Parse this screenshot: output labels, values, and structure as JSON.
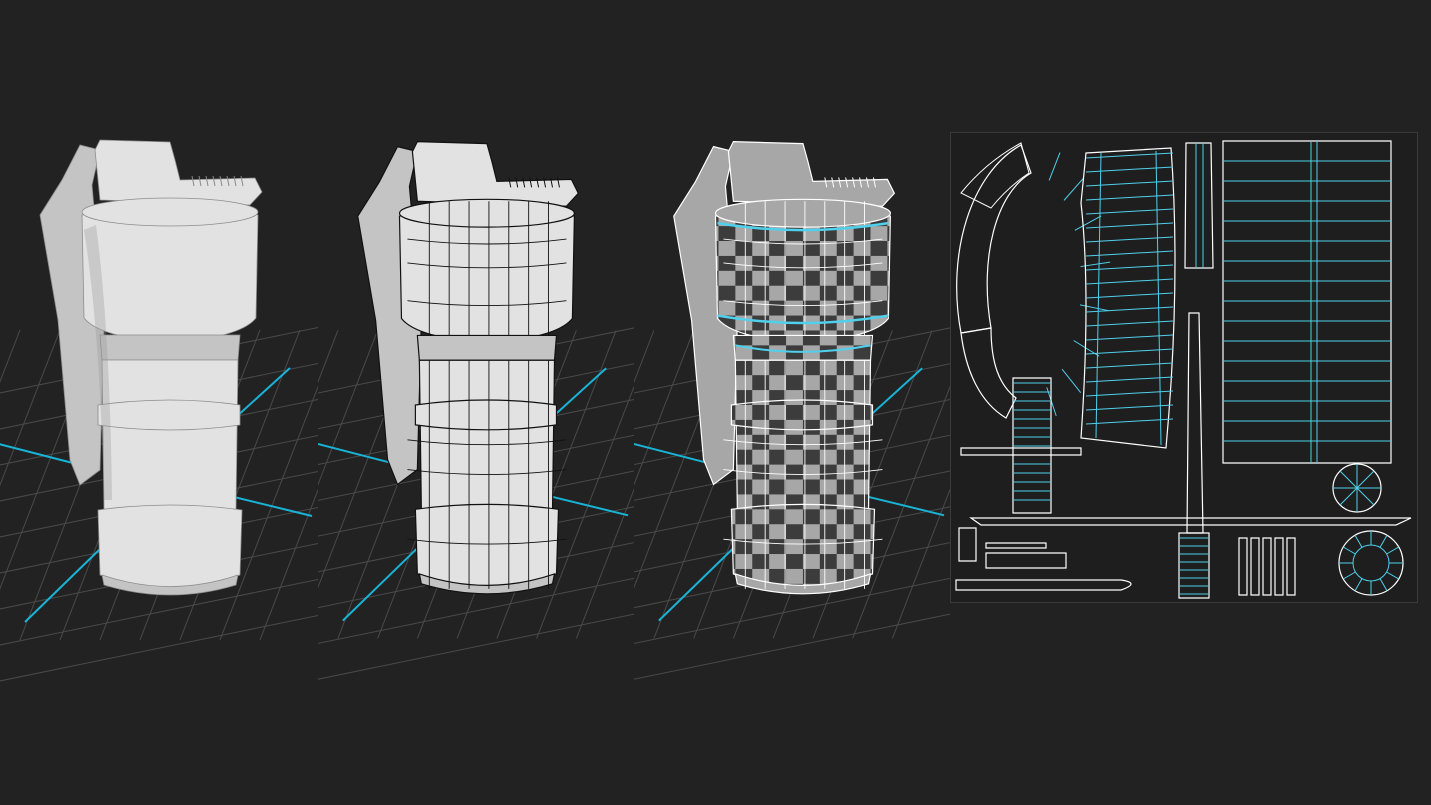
{
  "scene": {
    "views": [
      {
        "id": "shaded",
        "mode": "shaded"
      },
      {
        "id": "wireframe",
        "mode": "wireframe-on-shaded"
      },
      {
        "id": "uv-checker",
        "mode": "uv-checker"
      },
      {
        "id": "uv-layout",
        "mode": "uv-layout"
      }
    ],
    "object_icon": "grenade-model-icon"
  },
  "colors": {
    "background": "#222222",
    "grid": "#4a4a4a",
    "axis": "#19b3d6",
    "model_light": "#e2e2e2",
    "model_mid": "#c4c4c4",
    "model_shadow": "#9a9a9a",
    "wire": "#111111",
    "checker_dark": "#3c3c3c",
    "checker_light": "#a7a7a7",
    "uv_line": "#ffffff",
    "uv_seam": "#4fd0ec"
  }
}
